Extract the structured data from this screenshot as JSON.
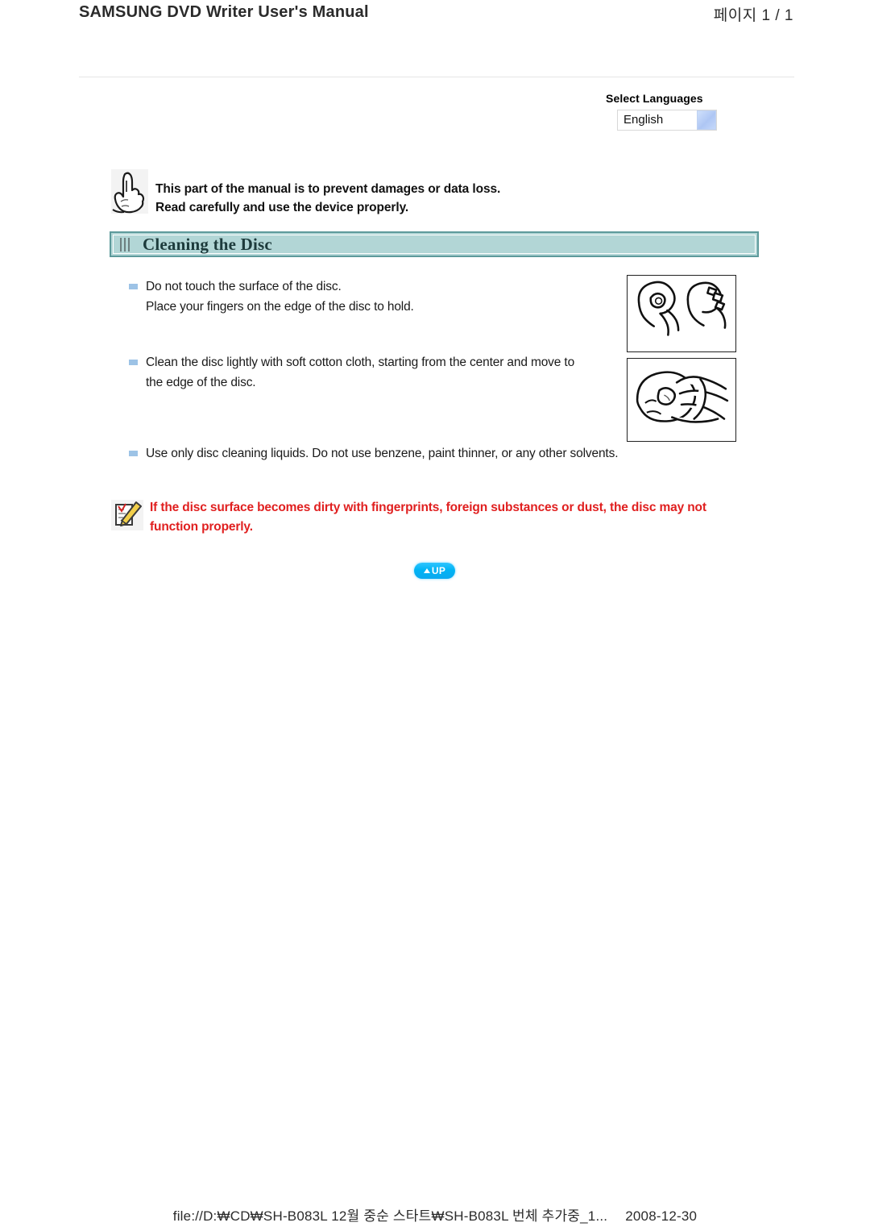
{
  "header": {
    "title": "SAMSUNG DVD Writer User's Manual",
    "page_label": "페이지 1 / 1"
  },
  "language": {
    "title": "Select Languages",
    "selected": "English",
    "dropdown_icon": "dropdown-arrow-icon"
  },
  "notice": {
    "icon": "pointing-hand-icon",
    "line1": "This part of the manual is to prevent damages or data loss.",
    "line2": "Read carefully and use the device properly."
  },
  "section": {
    "icon": "vertical-bars-icon",
    "title": "Cleaning the Disc"
  },
  "bullets": [
    {
      "line1": "Do not touch the surface of the disc.",
      "line2": "Place your fingers on the edge of the disc to hold."
    },
    {
      "line1": "Clean the disc lightly with soft cotton cloth, starting from the center and move to",
      "line2": "the edge of the disc."
    },
    {
      "line1": "Use only disc cleaning liquids. Do not use benzene, paint thinner, or any other solvents.",
      "line2": ""
    }
  ],
  "illustrations": {
    "top": "hands-holding-disc-illustration",
    "bottom": "hand-cleaning-disc-illustration"
  },
  "caution": {
    "icon": "note-pencil-icon",
    "line1": "If the disc surface becomes dirty with fingerprints, foreign substances or dust, the disc may not",
    "line2": "function properly.",
    "color": "#e01f1f"
  },
  "up_button": {
    "label": "UP",
    "icon": "up-triangle-icon"
  },
  "footer": {
    "path": "file://D:₩CD₩SH-B083L 12월 중순 스타트₩SH-B083L 번체 추가중_1...",
    "date": "2008-12-30"
  },
  "colors": {
    "section_bar_bg": "#b2d6d6",
    "section_bar_border": "#5d9a9b",
    "bullet": "#9dc3e6",
    "caution_red": "#e01f1f",
    "up_button": "#00b4f5",
    "dropdown_button": "#aec6f4"
  }
}
